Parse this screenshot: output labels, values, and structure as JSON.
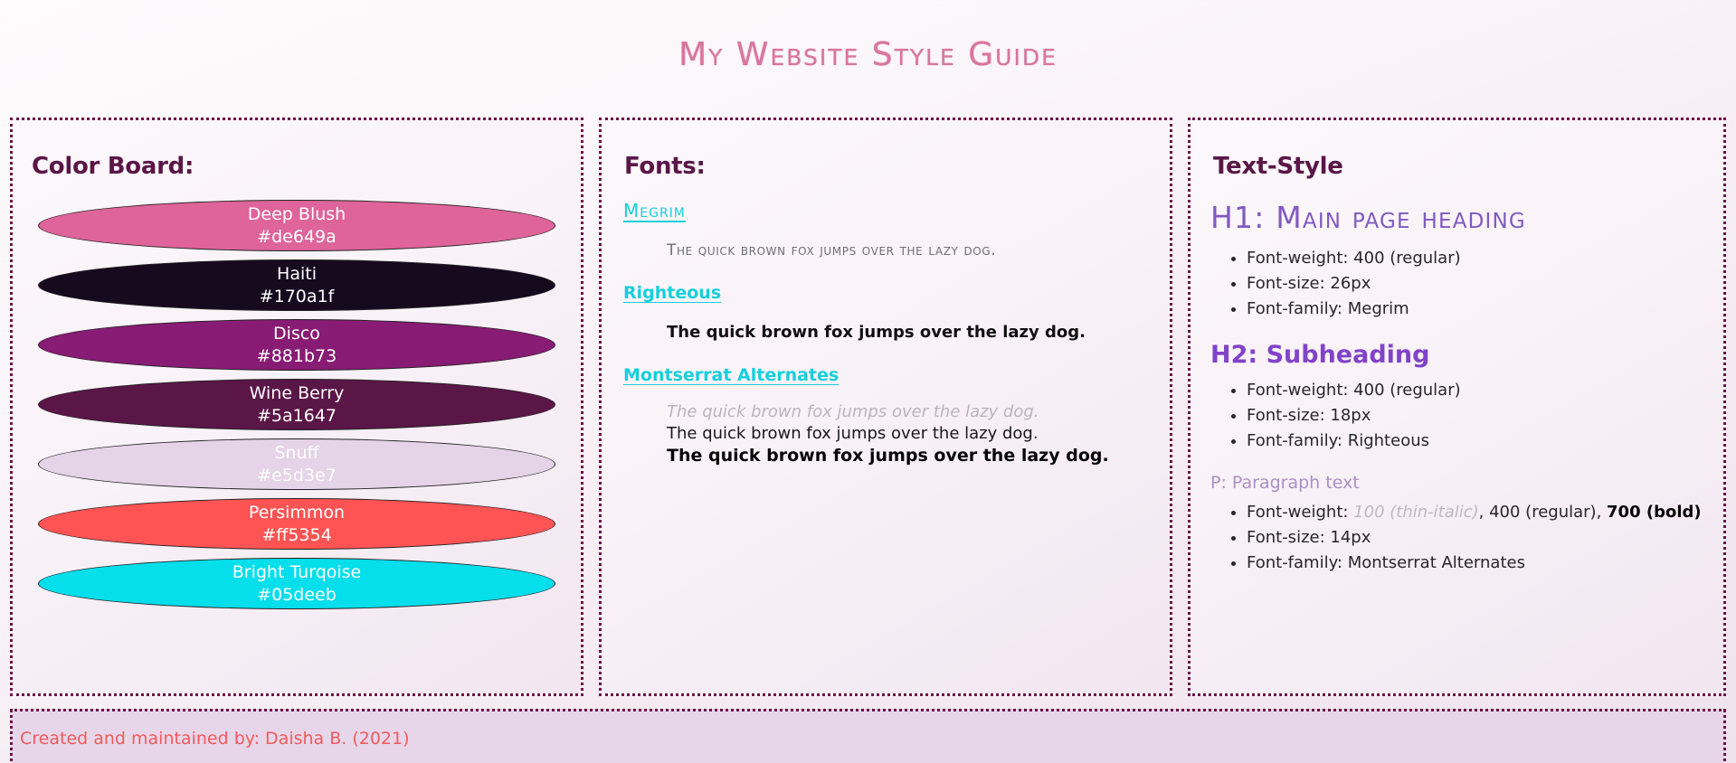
{
  "page": {
    "title": "My Website Style Guide",
    "title_color": "#d8769f",
    "background": "#fbf6f9",
    "panel_border_color": "#6b1347"
  },
  "color_board": {
    "heading": "Color Board:",
    "swatches": [
      {
        "name": "Deep Blush",
        "hex": "#de649a"
      },
      {
        "name": "Haiti",
        "hex": "#170a1f"
      },
      {
        "name": "Disco",
        "hex": "#881b73"
      },
      {
        "name": "Wine Berry",
        "hex": "#5a1647"
      },
      {
        "name": "Snuff",
        "hex": "#e5d3e7"
      },
      {
        "name": "Persimmon",
        "hex": "#ff5354"
      },
      {
        "name": "Bright Turqoise",
        "hex": "#05deeb"
      }
    ]
  },
  "fonts": {
    "heading": "Fonts:",
    "link_color": "#16cfdc",
    "items": [
      {
        "name": "Megrim",
        "samples": [
          {
            "text": "The quick brown fox jumps over the lazy dog.",
            "style": "megrim-regular"
          }
        ]
      },
      {
        "name": "Righteous",
        "samples": [
          {
            "text": "The quick brown fox jumps over the lazy dog.",
            "style": "righteous-regular"
          }
        ]
      },
      {
        "name": "Montserrat Alternates",
        "samples": [
          {
            "text": "The quick brown fox jumps over the lazy dog.",
            "style": "thin-italic"
          },
          {
            "text": "The quick brown fox jumps over the lazy dog.",
            "style": "regular"
          },
          {
            "text": "The quick brown fox jumps over the lazy dog.",
            "style": "bold"
          }
        ]
      }
    ]
  },
  "text_style": {
    "heading": "Text-Style",
    "h1": {
      "label": "H1: Main page heading",
      "color": "#8159c0",
      "specs": [
        "Font-weight: 400 (regular)",
        "Font-size: 26px",
        "Font-family: Megrim"
      ]
    },
    "h2": {
      "label": "H2: Subheading",
      "color": "#8143c9",
      "specs": [
        "Font-weight: 400 (regular)",
        "Font-size: 18px",
        "Font-family: Righteous"
      ]
    },
    "p": {
      "label": "P: Paragraph text",
      "color": "#ab8fc4",
      "weight_prefix": "Font-weight: ",
      "weight_thin": "100 (thin-italic)",
      "weight_mid": ", 400 (regular), ",
      "weight_bold": "700 (bold)",
      "specs": [
        "Font-size: 14px",
        "Font-family: Montserrat Alternates"
      ]
    }
  },
  "footer": {
    "text": "Created and maintained by: Daisha B. (2021)",
    "text_color": "#f05b5c"
  }
}
